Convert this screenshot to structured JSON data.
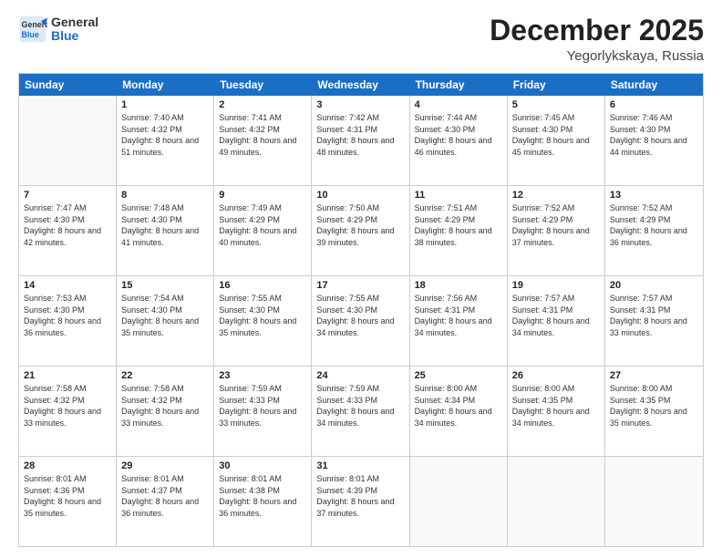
{
  "header": {
    "logo_line1": "General",
    "logo_line2": "Blue",
    "month": "December 2025",
    "location": "Yegorlykskaya, Russia"
  },
  "days_of_week": [
    "Sunday",
    "Monday",
    "Tuesday",
    "Wednesday",
    "Thursday",
    "Friday",
    "Saturday"
  ],
  "weeks": [
    [
      {
        "day": "",
        "empty": true
      },
      {
        "day": "1",
        "sunrise": "7:40 AM",
        "sunset": "4:32 PM",
        "daylight": "8 hours and 51 minutes."
      },
      {
        "day": "2",
        "sunrise": "7:41 AM",
        "sunset": "4:32 PM",
        "daylight": "8 hours and 49 minutes."
      },
      {
        "day": "3",
        "sunrise": "7:42 AM",
        "sunset": "4:31 PM",
        "daylight": "8 hours and 48 minutes."
      },
      {
        "day": "4",
        "sunrise": "7:44 AM",
        "sunset": "4:30 PM",
        "daylight": "8 hours and 46 minutes."
      },
      {
        "day": "5",
        "sunrise": "7:45 AM",
        "sunset": "4:30 PM",
        "daylight": "8 hours and 45 minutes."
      },
      {
        "day": "6",
        "sunrise": "7:46 AM",
        "sunset": "4:30 PM",
        "daylight": "8 hours and 44 minutes."
      }
    ],
    [
      {
        "day": "7",
        "sunrise": "7:47 AM",
        "sunset": "4:30 PM",
        "daylight": "8 hours and 42 minutes."
      },
      {
        "day": "8",
        "sunrise": "7:48 AM",
        "sunset": "4:30 PM",
        "daylight": "8 hours and 41 minutes."
      },
      {
        "day": "9",
        "sunrise": "7:49 AM",
        "sunset": "4:29 PM",
        "daylight": "8 hours and 40 minutes."
      },
      {
        "day": "10",
        "sunrise": "7:50 AM",
        "sunset": "4:29 PM",
        "daylight": "8 hours and 39 minutes."
      },
      {
        "day": "11",
        "sunrise": "7:51 AM",
        "sunset": "4:29 PM",
        "daylight": "8 hours and 38 minutes."
      },
      {
        "day": "12",
        "sunrise": "7:52 AM",
        "sunset": "4:29 PM",
        "daylight": "8 hours and 37 minutes."
      },
      {
        "day": "13",
        "sunrise": "7:52 AM",
        "sunset": "4:29 PM",
        "daylight": "8 hours and 36 minutes."
      }
    ],
    [
      {
        "day": "14",
        "sunrise": "7:53 AM",
        "sunset": "4:30 PM",
        "daylight": "8 hours and 36 minutes."
      },
      {
        "day": "15",
        "sunrise": "7:54 AM",
        "sunset": "4:30 PM",
        "daylight": "8 hours and 35 minutes."
      },
      {
        "day": "16",
        "sunrise": "7:55 AM",
        "sunset": "4:30 PM",
        "daylight": "8 hours and 35 minutes."
      },
      {
        "day": "17",
        "sunrise": "7:55 AM",
        "sunset": "4:30 PM",
        "daylight": "8 hours and 34 minutes."
      },
      {
        "day": "18",
        "sunrise": "7:56 AM",
        "sunset": "4:31 PM",
        "daylight": "8 hours and 34 minutes."
      },
      {
        "day": "19",
        "sunrise": "7:57 AM",
        "sunset": "4:31 PM",
        "daylight": "8 hours and 34 minutes."
      },
      {
        "day": "20",
        "sunrise": "7:57 AM",
        "sunset": "4:31 PM",
        "daylight": "8 hours and 33 minutes."
      }
    ],
    [
      {
        "day": "21",
        "sunrise": "7:58 AM",
        "sunset": "4:32 PM",
        "daylight": "8 hours and 33 minutes."
      },
      {
        "day": "22",
        "sunrise": "7:58 AM",
        "sunset": "4:32 PM",
        "daylight": "8 hours and 33 minutes."
      },
      {
        "day": "23",
        "sunrise": "7:59 AM",
        "sunset": "4:33 PM",
        "daylight": "8 hours and 33 minutes."
      },
      {
        "day": "24",
        "sunrise": "7:59 AM",
        "sunset": "4:33 PM",
        "daylight": "8 hours and 34 minutes."
      },
      {
        "day": "25",
        "sunrise": "8:00 AM",
        "sunset": "4:34 PM",
        "daylight": "8 hours and 34 minutes."
      },
      {
        "day": "26",
        "sunrise": "8:00 AM",
        "sunset": "4:35 PM",
        "daylight": "8 hours and 34 minutes."
      },
      {
        "day": "27",
        "sunrise": "8:00 AM",
        "sunset": "4:35 PM",
        "daylight": "8 hours and 35 minutes."
      }
    ],
    [
      {
        "day": "28",
        "sunrise": "8:01 AM",
        "sunset": "4:36 PM",
        "daylight": "8 hours and 35 minutes."
      },
      {
        "day": "29",
        "sunrise": "8:01 AM",
        "sunset": "4:37 PM",
        "daylight": "8 hours and 36 minutes."
      },
      {
        "day": "30",
        "sunrise": "8:01 AM",
        "sunset": "4:38 PM",
        "daylight": "8 hours and 36 minutes."
      },
      {
        "day": "31",
        "sunrise": "8:01 AM",
        "sunset": "4:39 PM",
        "daylight": "8 hours and 37 minutes."
      },
      {
        "day": "",
        "empty": true
      },
      {
        "day": "",
        "empty": true
      },
      {
        "day": "",
        "empty": true
      }
    ]
  ],
  "labels": {
    "sunrise": "Sunrise:",
    "sunset": "Sunset:",
    "daylight": "Daylight:"
  }
}
